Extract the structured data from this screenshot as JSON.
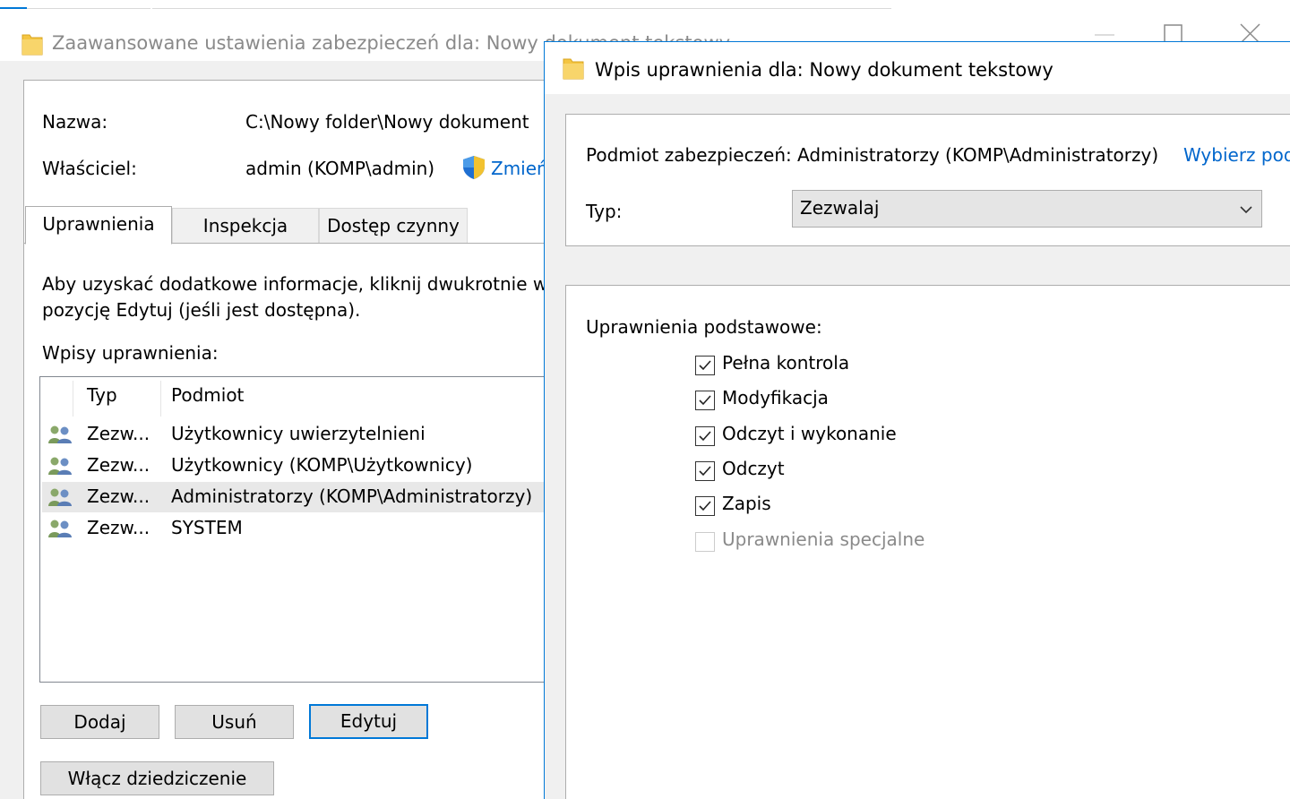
{
  "bg_window": {
    "title": "Zaawansowane ustawienia zabezpieczeń dla: Nowy dokument tekstowy",
    "name_label": "Nazwa:",
    "name_value": "C:\\Nowy folder\\Nowy dokument",
    "owner_label": "Właściciel:",
    "owner_value": "admin (KOMP\\admin)",
    "change_link": "Zmień",
    "tabs": [
      {
        "label": "Uprawnienia"
      },
      {
        "label": "Inspekcja"
      },
      {
        "label": "Dostęp czynny"
      }
    ],
    "info_line1": "Aby uzyskać dodatkowe informacje, kliknij dwukrotnie w",
    "info_line2": "pozycję Edytuj (jeśli jest dostępna).",
    "entries_label": "Wpisy uprawnienia:",
    "columns": {
      "type": "Typ",
      "principal": "Podmiot"
    },
    "entries": [
      {
        "type": "Zezw...",
        "principal": "Użytkownicy uwierzytelnieni"
      },
      {
        "type": "Zezw...",
        "principal": "Użytkownicy (KOMP\\Użytkownicy)"
      },
      {
        "type": "Zezw...",
        "principal": "Administratorzy (KOMP\\Administratorzy)"
      },
      {
        "type": "Zezw...",
        "principal": "SYSTEM"
      }
    ],
    "add_button": "Dodaj",
    "remove_button": "Usuń",
    "edit_button": "Edytuj",
    "inheritance_button": "Włącz dziedziczenie"
  },
  "fg_dialog": {
    "title": "Wpis uprawnienia dla: Nowy dokument tekstowy",
    "principal_label": "Podmiot zabezpieczeń:",
    "principal_value": "Administratorzy (KOMP\\Administratorzy)",
    "select_principal_link": "Wybierz pod",
    "type_label": "Typ:",
    "type_value": "Zezwalaj",
    "basic_permissions_label": "Uprawnienia podstawowe:",
    "permissions": [
      {
        "label": "Pełna kontrola",
        "checked": true,
        "enabled": true
      },
      {
        "label": "Modyfikacja",
        "checked": true,
        "enabled": true
      },
      {
        "label": "Odczyt i wykonanie",
        "checked": true,
        "enabled": true
      },
      {
        "label": "Odczyt",
        "checked": true,
        "enabled": true
      },
      {
        "label": "Zapis",
        "checked": true,
        "enabled": true
      },
      {
        "label": "Uprawnienia specjalne",
        "checked": false,
        "enabled": false
      }
    ]
  },
  "icons": {
    "folder": "folder-icon",
    "users": "users-group-icon",
    "shield": "uac-shield-icon",
    "chevron": "chevron-down-icon",
    "check": "checkmark-icon"
  },
  "colors": {
    "accent": "#0078d7",
    "link": "#0066cc",
    "folder": "#f4c542",
    "selected_row": "#e8e8e8"
  }
}
